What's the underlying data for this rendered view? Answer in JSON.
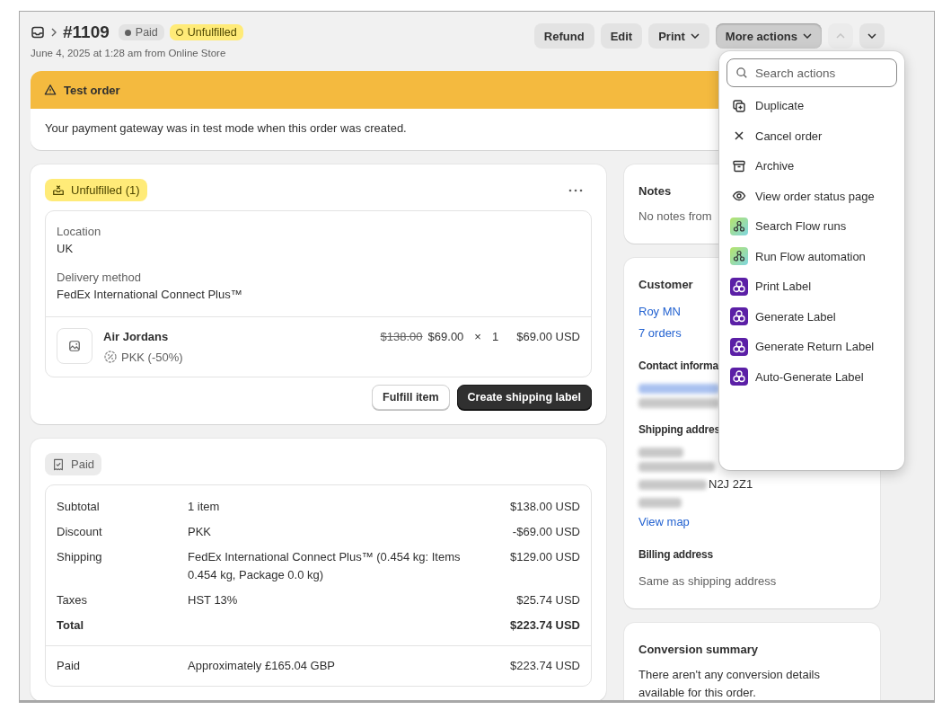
{
  "header": {
    "order_number": "#1109",
    "subtitle": "June 4, 2025 at 1:28 am from Online Store",
    "badges": [
      {
        "label": "Paid",
        "kind": "paid"
      },
      {
        "label": "Unfulfilled",
        "kind": "unfulfilled"
      }
    ],
    "actions": [
      {
        "label": "Refund",
        "kind": "plain",
        "expanded": false
      },
      {
        "label": "Edit",
        "kind": "plain",
        "expanded": false
      },
      {
        "label": "Print",
        "kind": "menu",
        "expanded": false
      },
      {
        "label": "More actions",
        "kind": "menu",
        "expanded": true
      }
    ],
    "pager": [
      {
        "kind": "previous",
        "disabled": true
      },
      {
        "kind": "next",
        "disabled": false
      }
    ]
  },
  "banner": {
    "title": "Test order",
    "message": "Your payment gateway was in test mode when this order was created."
  },
  "fulfillment": {
    "status": "Unfulfilled (1)",
    "location_label": "Location",
    "location": "UK",
    "delivery_label": "Delivery method",
    "delivery": "FedEx International Connect Plus™",
    "item": {
      "name": "Air Jordans",
      "discount": "PKK (-50%)",
      "original_price": "$138.00",
      "price": "$69.00",
      "times": "×",
      "quantity": "1",
      "total": "$69.00 USD"
    },
    "buttons": [
      {
        "label": "Fulfill item",
        "kind": "secondary"
      },
      {
        "label": "Create shipping label",
        "kind": "primary"
      }
    ]
  },
  "payment": {
    "status": "Paid",
    "rows": [
      {
        "label": "Subtotal",
        "detail": "1 item",
        "amount": "$138.00 USD",
        "kind": "line"
      },
      {
        "label": "Discount",
        "detail": "PKK",
        "amount": "-$69.00 USD",
        "kind": "line"
      },
      {
        "label": "Shipping",
        "detail": "FedEx International Connect Plus™ (0.454 kg: Items 0.454 kg, Package 0.0 kg)",
        "amount": "$129.00 USD",
        "kind": "line"
      },
      {
        "label": "Taxes",
        "detail": "HST 13%",
        "amount": "$25.74 USD",
        "kind": "line"
      },
      {
        "label": "Total",
        "amount": "$223.74 USD",
        "kind": "total"
      }
    ],
    "paid": {
      "label": "Paid",
      "detail": "Approximately £165.04 GBP",
      "amount": "$223.74 USD"
    }
  },
  "notes": {
    "title": "Notes",
    "text": "No notes from"
  },
  "customer": {
    "title": "Customer",
    "name": "Roy MN",
    "orders": "7 orders",
    "contact_title": "Contact informa",
    "shipping_title": "Shipping addres",
    "postcode": "N2J 2Z1",
    "view_map": "View map",
    "billing_title": "Billing address",
    "billing_text": "Same as shipping address"
  },
  "conversion": {
    "title": "Conversion summary",
    "text": "There aren't any conversion details available for this order."
  },
  "menu": {
    "placeholder": "Search actions",
    "items": [
      {
        "label": "Duplicate",
        "kind": "duplicate"
      },
      {
        "label": "Cancel order",
        "kind": "close"
      },
      {
        "label": "Archive",
        "kind": "archive"
      },
      {
        "label": "View order status page",
        "kind": "eye"
      },
      {
        "label": "Search Flow runs",
        "kind": "flow"
      },
      {
        "label": "Run Flow automation",
        "kind": "flow"
      },
      {
        "label": "Print Label",
        "kind": "label"
      },
      {
        "label": "Generate Label",
        "kind": "label"
      },
      {
        "label": "Generate Return Label",
        "kind": "label"
      },
      {
        "label": "Auto-Generate Label",
        "kind": "label"
      }
    ]
  }
}
